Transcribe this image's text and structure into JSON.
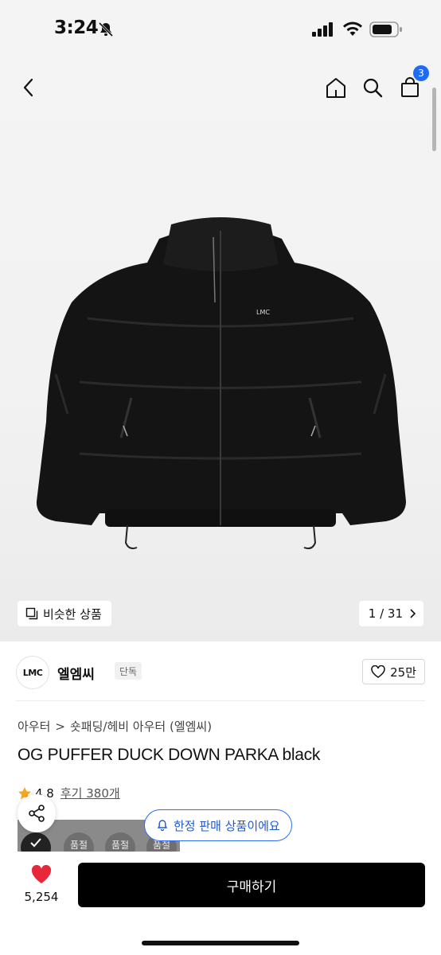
{
  "status": {
    "time": "3:24"
  },
  "nav": {
    "cart_count": "3"
  },
  "image_overlay": {
    "similar_label": "비슷한 상품",
    "page_indicator": "1 / 31"
  },
  "jacket_logo_text": "LMC",
  "brand": {
    "logo_text": "LMC",
    "name": "엘엠씨",
    "tag": "단독",
    "likes": "25만"
  },
  "breadcrumb": {
    "category": "아우터",
    "separator": ">",
    "subcategory": "숏패딩/헤비 아우터 (엘엠씨)"
  },
  "product": {
    "title": "OG PUFFER DUCK DOWN PARKA black",
    "rating": "4.8",
    "reviews": "후기 380개"
  },
  "thumbnails": [
    "품절",
    "품절",
    "품절"
  ],
  "limited_notice": "한정 판매 상품이에요",
  "bottom": {
    "wish_count": "5,254",
    "buy_label": "구매하기"
  },
  "colors": {
    "accent_blue": "#1e6cf5",
    "heart_red": "#e8283a",
    "star": "#f5a623"
  }
}
